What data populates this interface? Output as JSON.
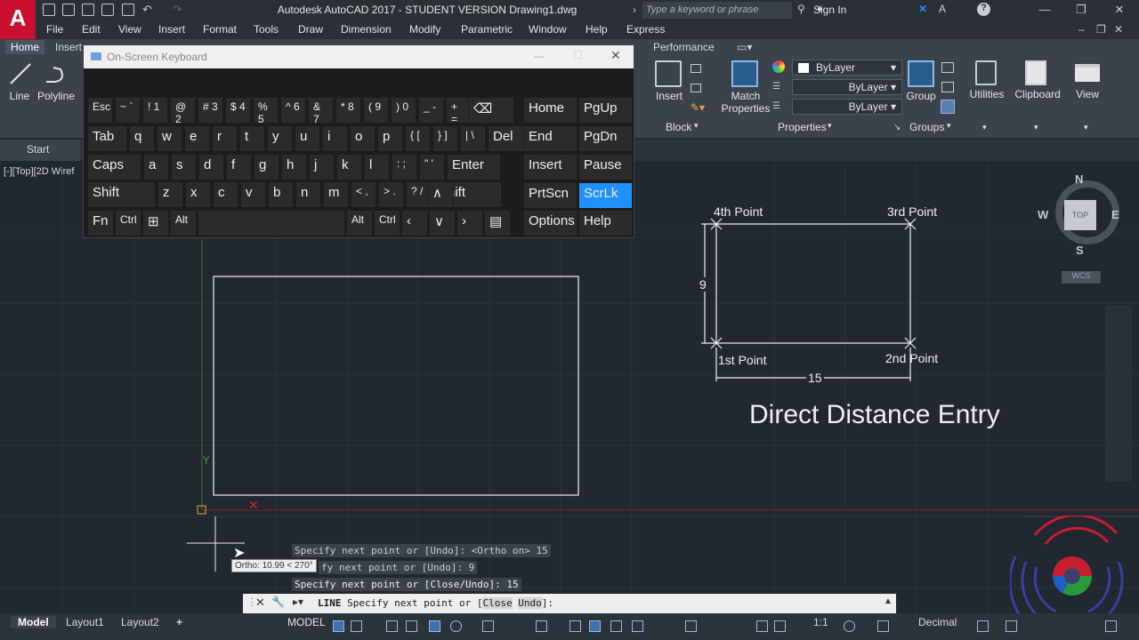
{
  "app": {
    "title": "Autodesk AutoCAD 2017 - STUDENT VERSION    Drawing1.dwg",
    "logo": "A",
    "search_placeholder": "Type a keyword or phrase",
    "sign_in": "Sign In"
  },
  "menubar": [
    "File",
    "Edit",
    "View",
    "Insert",
    "Format",
    "Tools",
    "Draw",
    "Dimension",
    "Modify",
    "Parametric",
    "Window",
    "Help",
    "Express"
  ],
  "ribbon_tabs": {
    "home": "Home",
    "insert": "Insert",
    "performance": "Performance"
  },
  "ribbon": {
    "line": "Line",
    "polyline": "Polyline",
    "insert": "Insert",
    "block_panel": "Block",
    "match_properties_1": "Match",
    "match_properties_2": "Properties",
    "bylayer_color": "ByLayer",
    "bylayer_linetype": "ByLayer",
    "bylayer_lineweight": "ByLayer",
    "properties_panel": "Properties",
    "group": "Group",
    "groups_panel": "Groups",
    "utilities": "Utilities",
    "clipboard": "Clipboard",
    "view": "View"
  },
  "file_tabs": {
    "start": "Start"
  },
  "viewport_label": "[-][Top][2D Wiref",
  "osk": {
    "title": "On-Screen Keyboard",
    "row1": [
      "Esc",
      "~ `",
      "! 1",
      "@ 2",
      "# 3",
      "$ 4",
      "% 5",
      "^ 6",
      "& 7",
      "* 8",
      "( 9",
      ") 0",
      "_ -",
      "+ ="
    ],
    "row2": [
      "Tab",
      "q",
      "w",
      "e",
      "r",
      "t",
      "y",
      "u",
      "i",
      "o",
      "p",
      "{ [",
      "} ]",
      "| \\",
      "Del"
    ],
    "row3": [
      "Caps",
      "a",
      "s",
      "d",
      "f",
      "g",
      "h",
      "j",
      "k",
      "l",
      ": ;",
      "\" '",
      "Enter"
    ],
    "row4": [
      "Shift",
      "z",
      "x",
      "c",
      "v",
      "b",
      "n",
      "m",
      "< ,",
      "> .",
      "? /",
      "Shift"
    ],
    "row5": [
      "Fn",
      "Ctrl",
      "Alt",
      "Alt",
      "Ctrl"
    ],
    "nav": [
      "Home",
      "PgUp",
      "End",
      "PgDn",
      "Insert",
      "Pause",
      "PrtScn",
      "ScrLk",
      "Options",
      "Help"
    ]
  },
  "viewcube": {
    "top": "TOP",
    "n": "N",
    "s": "S",
    "e": "E",
    "w": "W",
    "wcs": "WCS"
  },
  "diagram": {
    "p4": "4th Point",
    "p3": "3rd Point",
    "p1": "1st Point",
    "p2": "2nd Point",
    "height": "9",
    "width": "15",
    "caption": "Direct Distance Entry"
  },
  "command": {
    "hist1": "Specify next point or [Undo]:  <Ortho on> 15",
    "hist2": "fy next point or [Undo]: 9",
    "hist3": "Specify next point or [Close/Undo]: 15",
    "prompt_cmd": "LINE",
    "prompt_text": "Specify next point or [",
    "opt_close": "Close",
    "opt_undo": "Undo",
    "prompt_end": "]:",
    "tooltip": "Ortho: 10.99 < 270°"
  },
  "statusbar": {
    "model": "Model",
    "layout1": "Layout1",
    "layout2": "Layout2",
    "add": "+",
    "model_space": "MODEL",
    "scale": "1:1",
    "units": "Decimal"
  },
  "colors": {
    "accent": "#1e90ff",
    "logo": "#c8102e",
    "canvas": "#212830",
    "ribbon": "#3b424c"
  }
}
